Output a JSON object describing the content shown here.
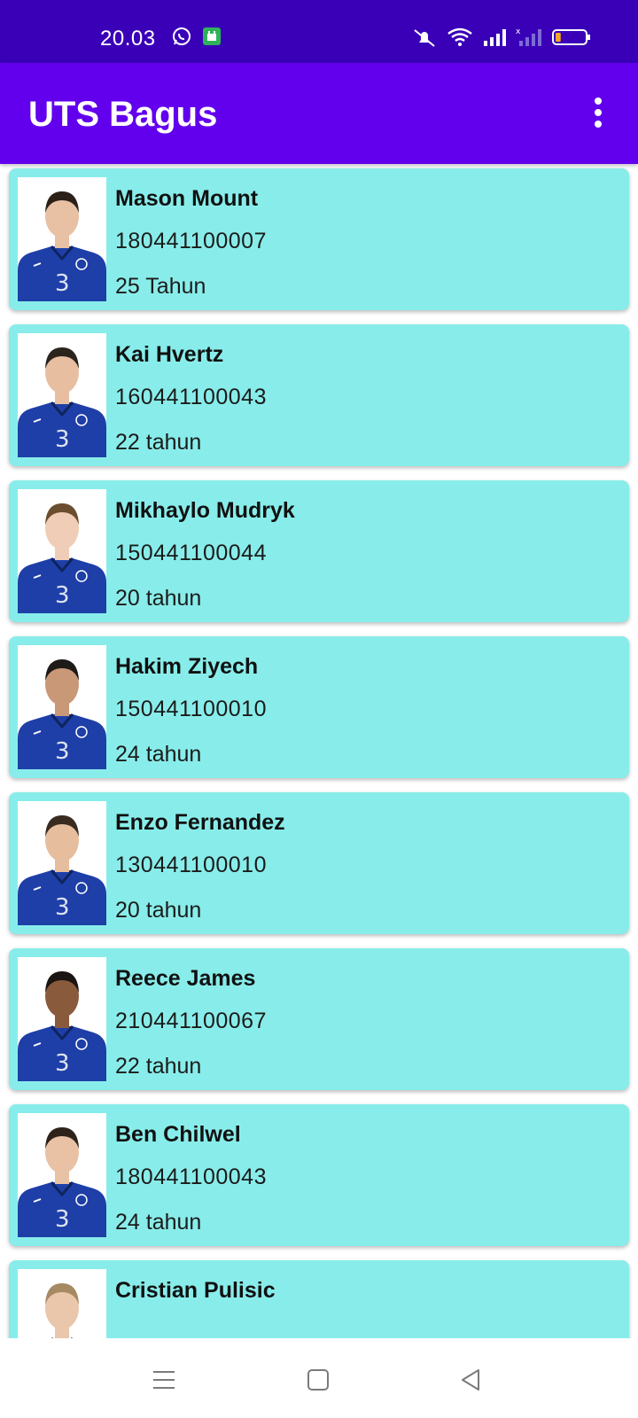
{
  "status_bar": {
    "time": "20.03",
    "left_icons": [
      "whatsapp-icon",
      "app-notification-icon"
    ],
    "right_icons": [
      "mute-icon",
      "wifi-icon",
      "signal-icon",
      "signal-no-sim-icon",
      "battery-icon"
    ],
    "battery_level": 0.18
  },
  "app_bar": {
    "title": "UTS Bagus",
    "menu_icon": "more-vert-icon"
  },
  "players": [
    {
      "name": "Mason Mount",
      "id": "180441100007",
      "age": "25 Tahun"
    },
    {
      "name": "Kai Hvertz",
      "id": "160441100043",
      "age": "22 tahun"
    },
    {
      "name": "Mikhaylo Mudryk",
      "id": "150441100044",
      "age": "20 tahun"
    },
    {
      "name": "Hakim Ziyech",
      "id": "150441100010",
      "age": "24 tahun"
    },
    {
      "name": "Enzo Fernandez",
      "id": "130441100010",
      "age": "20 tahun"
    },
    {
      "name": "Reece James",
      "id": "210441100067",
      "age": "22 tahun"
    },
    {
      "name": "Ben Chilwel",
      "id": "180441100043",
      "age": "24 tahun"
    },
    {
      "name": "Cristian Pulisic",
      "id": "",
      "age": ""
    }
  ],
  "nav_bar": {
    "icons": [
      "recent-apps-icon",
      "home-icon",
      "back-icon"
    ]
  },
  "colors": {
    "status_bar": "#3a00b8",
    "app_bar": "#6200ee",
    "card": "#88edea",
    "jersey": "#1e3fa8"
  }
}
